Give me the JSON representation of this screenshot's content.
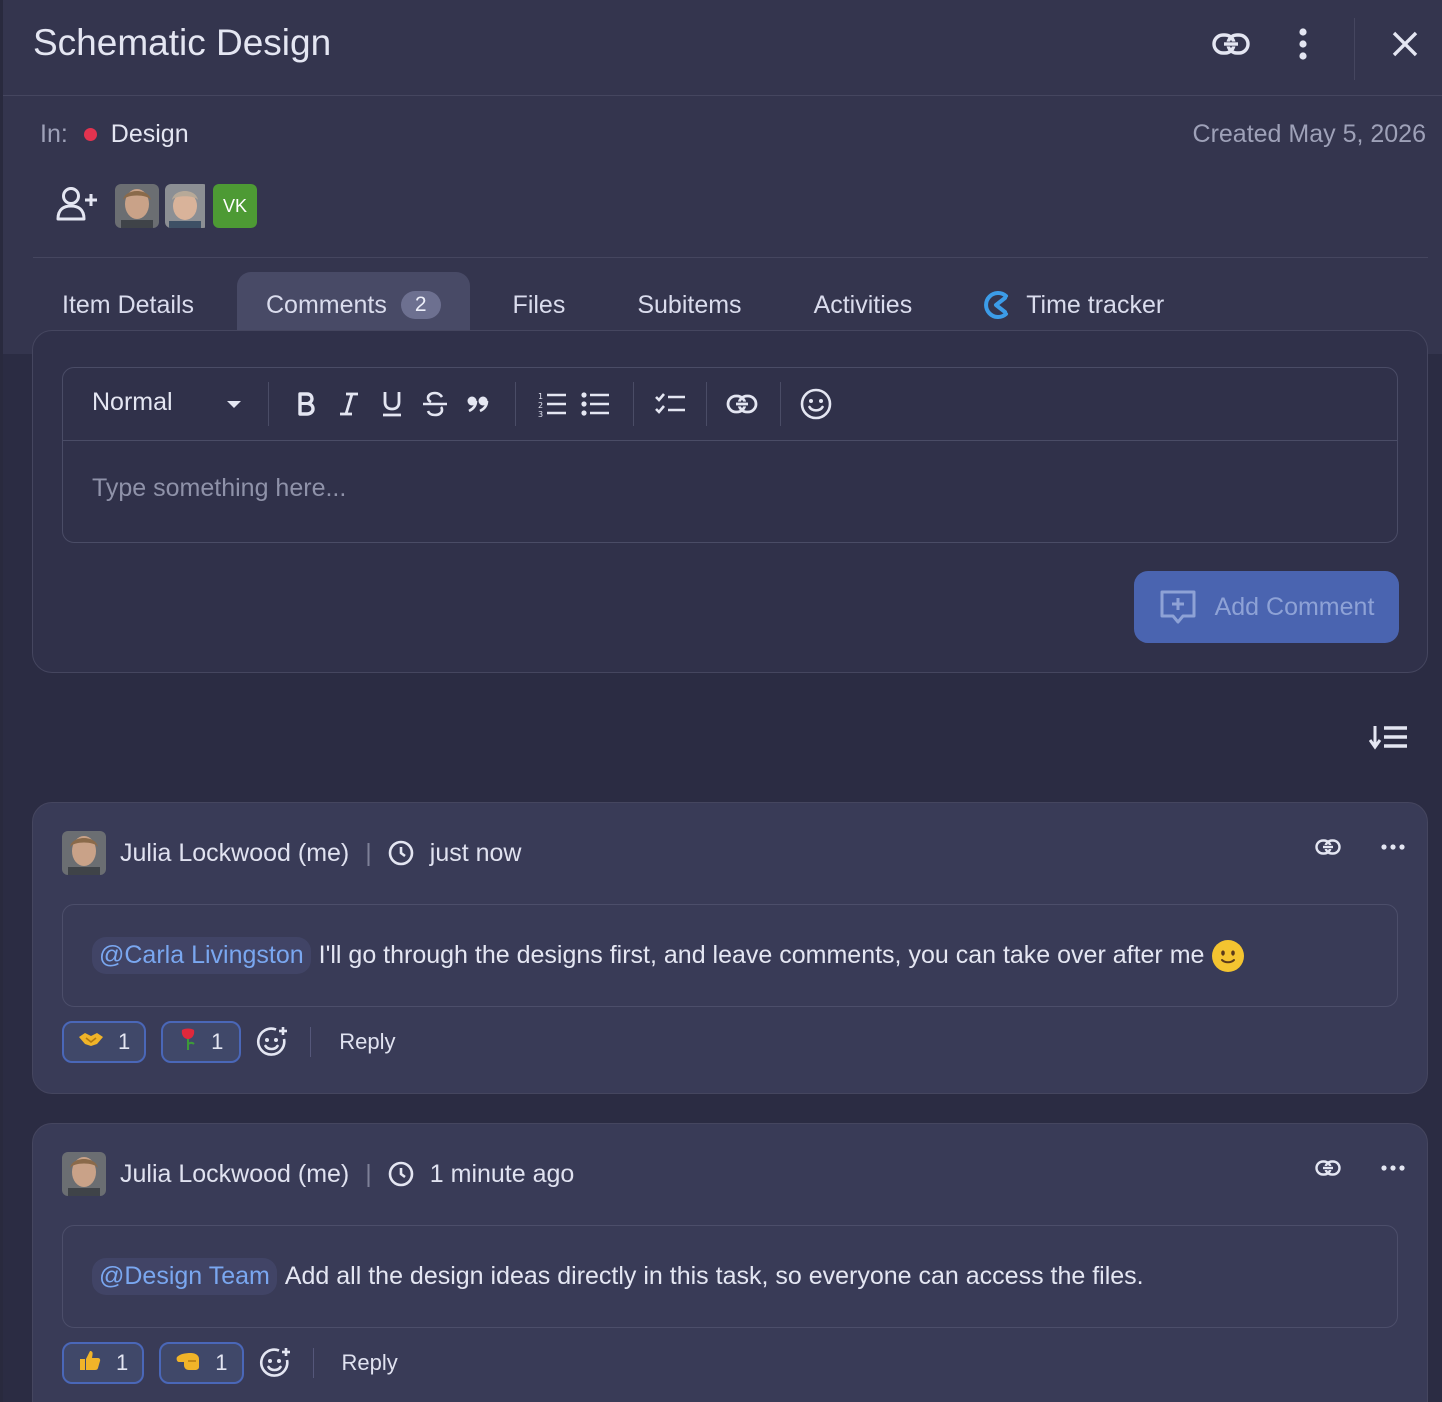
{
  "header": {
    "title": "Schematic Design",
    "in_label": "In:",
    "board": "Design",
    "board_color": "#e2334f",
    "created": "Created May 5, 2026",
    "icons": [
      "link-icon",
      "more-vertical-icon",
      "close-icon"
    ],
    "members": [
      {
        "type": "photo"
      },
      {
        "type": "photo"
      },
      {
        "type": "initials",
        "initials": "VK",
        "color": "#4d9a34"
      }
    ]
  },
  "tabs": [
    {
      "label": "Item Details"
    },
    {
      "label": "Comments",
      "badge": "2",
      "active": true
    },
    {
      "label": "Files"
    },
    {
      "label": "Subitems"
    },
    {
      "label": "Activities"
    },
    {
      "label": "Time tracker",
      "icon": "time-tracker-icon"
    }
  ],
  "editor": {
    "format": "Normal",
    "placeholder": "Type something here...",
    "tools": [
      "bold",
      "italic",
      "underline",
      "strikethrough",
      "quote",
      "ordered-list",
      "bullet-list",
      "checklist",
      "link",
      "emoji"
    ],
    "submit_label": "Add Comment"
  },
  "comments": [
    {
      "author": "Julia Lockwood (me)",
      "time": "just now",
      "mention": "@Carla Livingston",
      "text": "I'll go through the designs first, and leave comments, you can take over after me",
      "reactions": [
        {
          "emoji": "🤝",
          "count": "1"
        },
        {
          "emoji": "🌹",
          "count": "1"
        }
      ],
      "reply_label": "Reply"
    },
    {
      "author": "Julia Lockwood (me)",
      "time": "1 minute ago",
      "mention": "@Design Team",
      "text": "Add all the design ideas directly in this task, so everyone can access the files.",
      "reactions": [
        {
          "emoji": "👍",
          "count": "1"
        },
        {
          "emoji": "🫲",
          "count": "1"
        }
      ],
      "reply_label": "Reply"
    }
  ]
}
